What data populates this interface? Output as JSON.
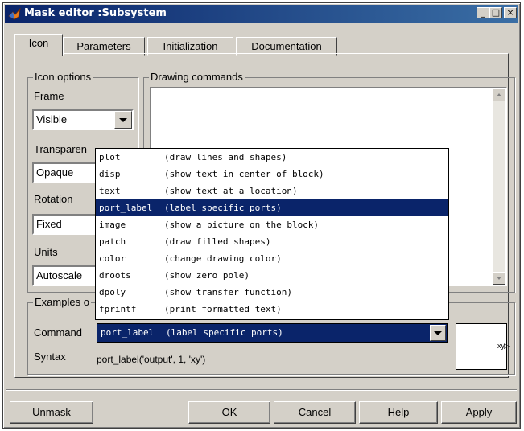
{
  "window": {
    "title": "Mask editor :Subsystem",
    "controls": [
      "_",
      "□",
      "×"
    ]
  },
  "tabs": [
    {
      "label": "Icon",
      "active": true
    },
    {
      "label": "Parameters",
      "active": false
    },
    {
      "label": "Initialization",
      "active": false
    },
    {
      "label": "Documentation",
      "active": false
    }
  ],
  "icon_options": {
    "title": "Icon options",
    "frame": {
      "label": "Frame",
      "value": "Visible"
    },
    "transparency": {
      "label": "Transparen",
      "value": "Opaque"
    },
    "rotation": {
      "label": "Rotation",
      "value": "Fixed"
    },
    "units": {
      "label": "Units",
      "value": "Autoscale"
    }
  },
  "drawing_commands": {
    "title": "Drawing commands",
    "value": ""
  },
  "examples": {
    "title": "Examples o",
    "command_label": "Command",
    "command_value": {
      "keyword": "port_label",
      "description": "(label specific ports)"
    },
    "syntax_label": "Syntax",
    "syntax_value": "port_label('output', 1, 'xy')",
    "preview_text": "xy"
  },
  "command_dropdown": {
    "selected_index": 3,
    "options": [
      {
        "keyword": "plot",
        "description": "(draw lines and shapes)"
      },
      {
        "keyword": "disp",
        "description": "(show text in center of block)"
      },
      {
        "keyword": "text",
        "description": "(show text at a location)"
      },
      {
        "keyword": "port_label",
        "description": "(label specific ports)"
      },
      {
        "keyword": "image",
        "description": "(show a picture on the block)"
      },
      {
        "keyword": "patch",
        "description": "(draw filled shapes)"
      },
      {
        "keyword": "color",
        "description": "(change drawing color)"
      },
      {
        "keyword": "droots",
        "description": "(show zero pole)"
      },
      {
        "keyword": "dpoly",
        "description": "(show transfer function)"
      },
      {
        "keyword": "fprintf",
        "description": "(print formatted text)"
      }
    ]
  },
  "buttons": {
    "unmask": "Unmask",
    "ok": "OK",
    "cancel": "Cancel",
    "help": "Help",
    "apply": "Apply"
  },
  "colors": {
    "titlebar": "#0a246a",
    "selection": "#0a246a",
    "face": "#d4d0c8"
  }
}
